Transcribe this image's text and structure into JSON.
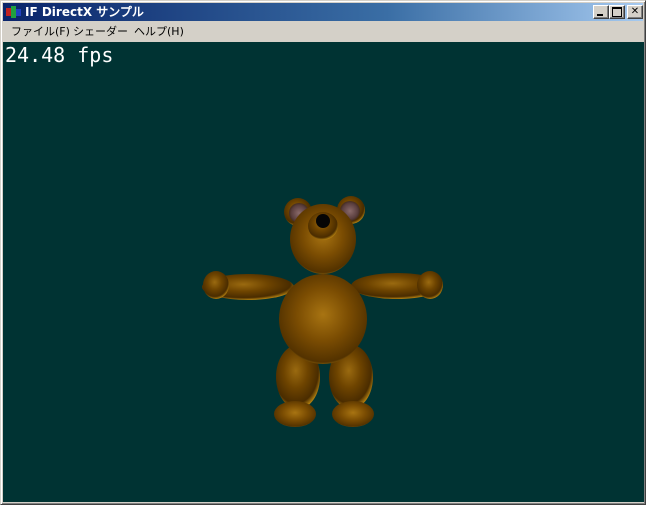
{
  "window": {
    "title": "IF DirectX サンプル",
    "buttons": {
      "minimize": "",
      "maximize": "",
      "close": "✕"
    }
  },
  "menu": {
    "items": [
      {
        "label": "ファイル(F)"
      },
      {
        "label": "シェーダー"
      },
      {
        "label": "ヘルプ(H)"
      }
    ]
  },
  "viewport": {
    "background_color": "#003333",
    "fps_text": "24.48 fps",
    "model": "teddy-bear"
  },
  "colors": {
    "titlebar_start": "#0a246a",
    "titlebar_end": "#a6caf0",
    "bear_body": "#8a5a00",
    "bear_highlight": "#c08a10",
    "bear_ear_inner": "#6a4848"
  }
}
